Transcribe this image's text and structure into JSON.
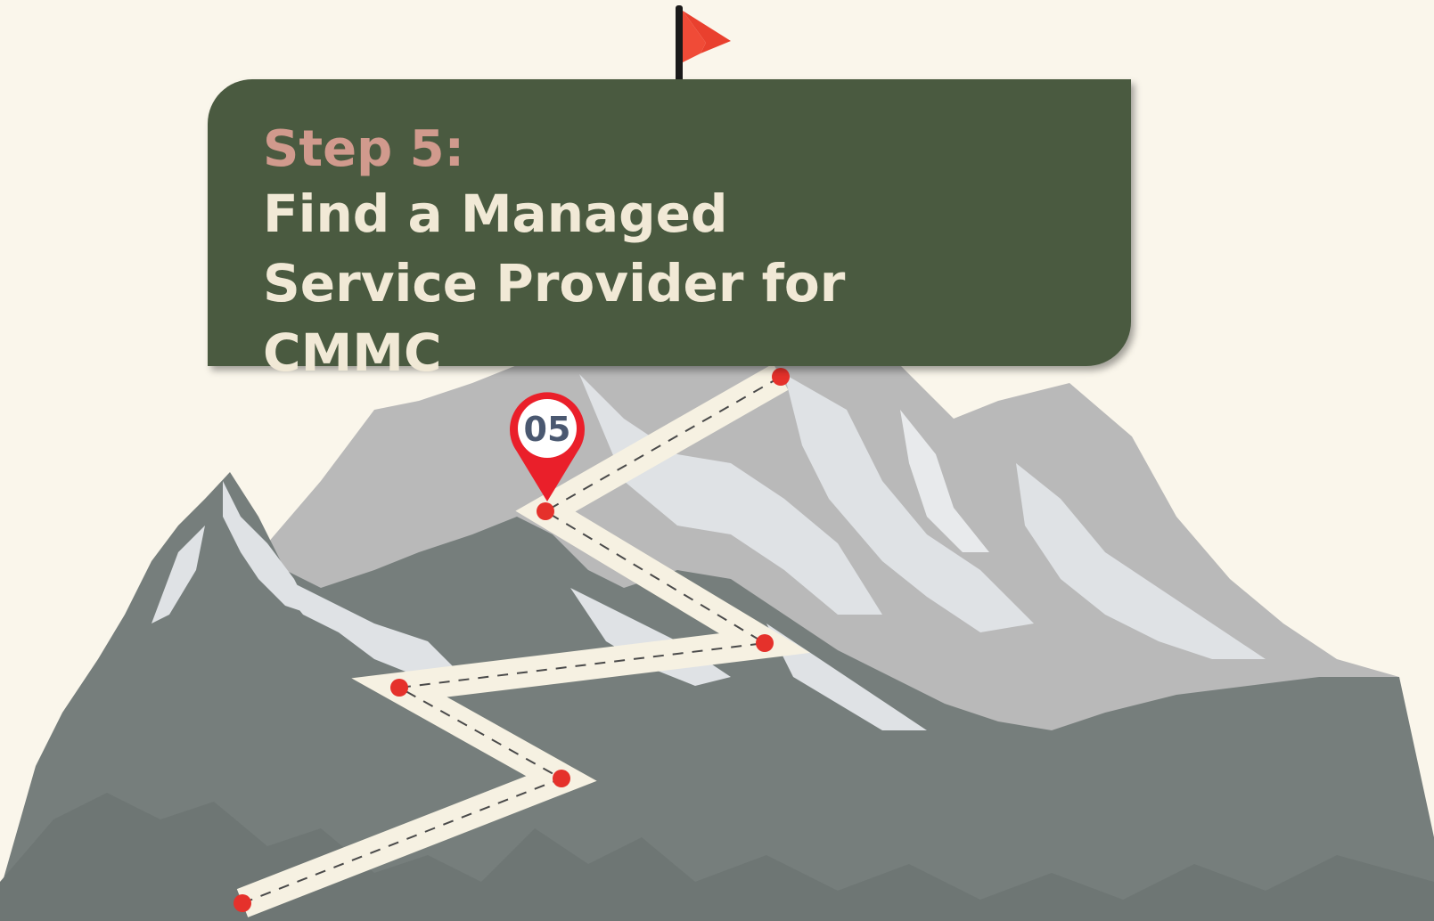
{
  "card": {
    "step_label": "Step 5:",
    "headline": "Find a Managed Service Provider for CMMC"
  },
  "marker": {
    "number": "05"
  },
  "colors": {
    "background": "#faf6eb",
    "card": "#4a5a40",
    "step_label": "#d19a8d",
    "headline": "#f1e9d6",
    "flag": "#e9402e",
    "pin": "#ea1f2a",
    "waypoint": "#e5312b",
    "road": "#f6f1e2",
    "mountain_back": "#b9b9b9",
    "mountain_front": "#767e7c",
    "snow": "#dfe2e5"
  },
  "icons": [
    "flag-icon",
    "map-pin-icon"
  ]
}
